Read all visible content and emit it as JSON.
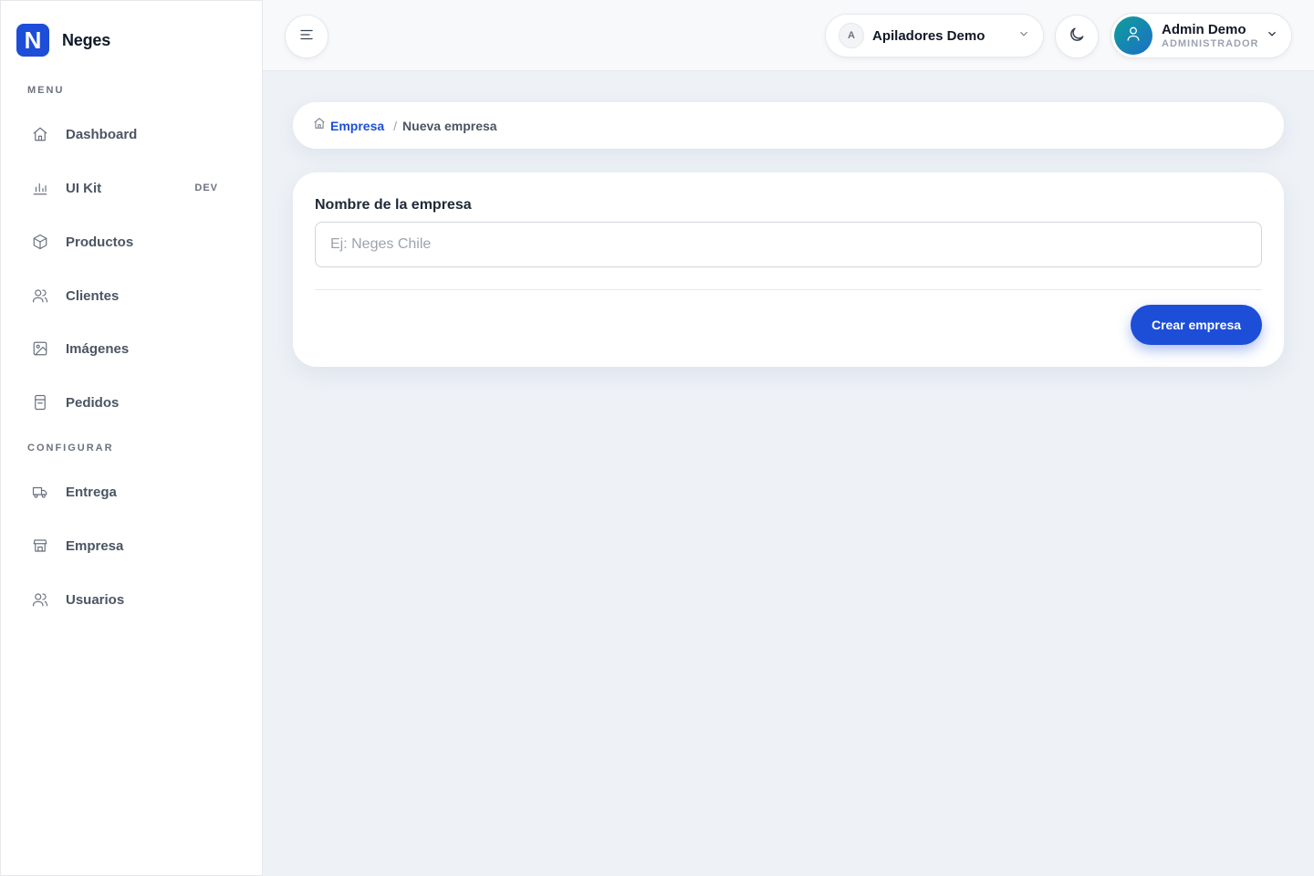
{
  "brand": {
    "logo_letter": "N",
    "name": "Neges"
  },
  "sidebar": {
    "sections": [
      {
        "label": "MENU"
      },
      {
        "label": "CONFIGURAR"
      }
    ],
    "menu_items": [
      {
        "label": "Dashboard",
        "icon": "home-icon"
      },
      {
        "label": "UI Kit",
        "icon": "bar-chart-icon",
        "badge": "DEV"
      },
      {
        "label": "Productos",
        "icon": "box-icon"
      },
      {
        "label": "Clientes",
        "icon": "users-icon"
      },
      {
        "label": "Imágenes",
        "icon": "image-icon"
      },
      {
        "label": "Pedidos",
        "icon": "receipt-icon"
      }
    ],
    "config_items": [
      {
        "label": "Entrega",
        "icon": "truck-icon"
      },
      {
        "label": "Empresa",
        "icon": "store-icon"
      },
      {
        "label": "Usuarios",
        "icon": "users-icon"
      }
    ]
  },
  "topbar": {
    "company": {
      "initial": "A",
      "name": "Apiladores Demo"
    },
    "user": {
      "name": "Admin Demo",
      "role": "ADMINISTRADOR"
    }
  },
  "breadcrumb": {
    "parent": "Empresa",
    "separator": "/",
    "current": "Nueva empresa"
  },
  "form": {
    "label": "Nombre de la empresa",
    "placeholder": "Ej: Neges Chile",
    "value": "",
    "submit_label": "Crear empresa"
  },
  "colors": {
    "accent": "#1d4ed8",
    "background": "#eef2f7"
  }
}
